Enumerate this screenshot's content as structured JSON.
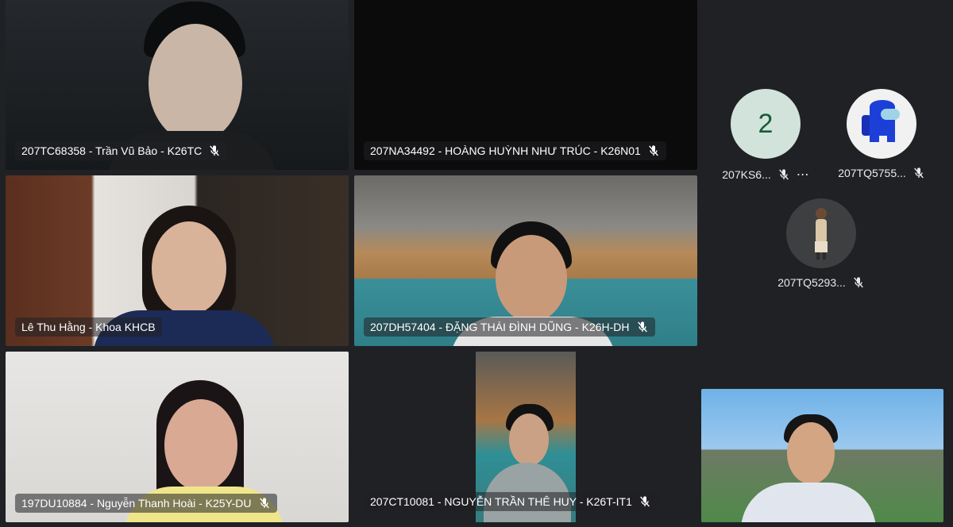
{
  "tiles": [
    {
      "name": "207TC68358 - Trần Vũ Bảo - K26TC"
    },
    {
      "name": "207NA34492 - HOÀNG HUỲNH NHƯ TRÚC - K26N01"
    },
    {
      "name": "Lê Thu Hằng - Khoa KHCB"
    },
    {
      "name": "207DH57404 - ĐẶNG THÁI ĐÌNH DŨNG - K26H-DH"
    },
    {
      "name": "197DU10884 - Nguyễn Thanh Hoài - K25Y-DU"
    },
    {
      "name": "207CT10081 - NGUYỄN TRẦN THÊ HUY - K26T-IT1"
    }
  ],
  "sidebar": {
    "overflow_count": "2",
    "participants": [
      {
        "label": "207KS6...",
        "more": "⋯"
      },
      {
        "label": "207TQ5755..."
      },
      {
        "label": "207TQ5293..."
      }
    ]
  },
  "colors": {
    "background": "#202124",
    "overflow_avatar": "#d2e3dc",
    "overflow_text": "#185c37",
    "among_us_red": "#1c3fd8"
  },
  "icons": {
    "mic_off": "mic-off-icon",
    "more": "more-options-icon"
  }
}
